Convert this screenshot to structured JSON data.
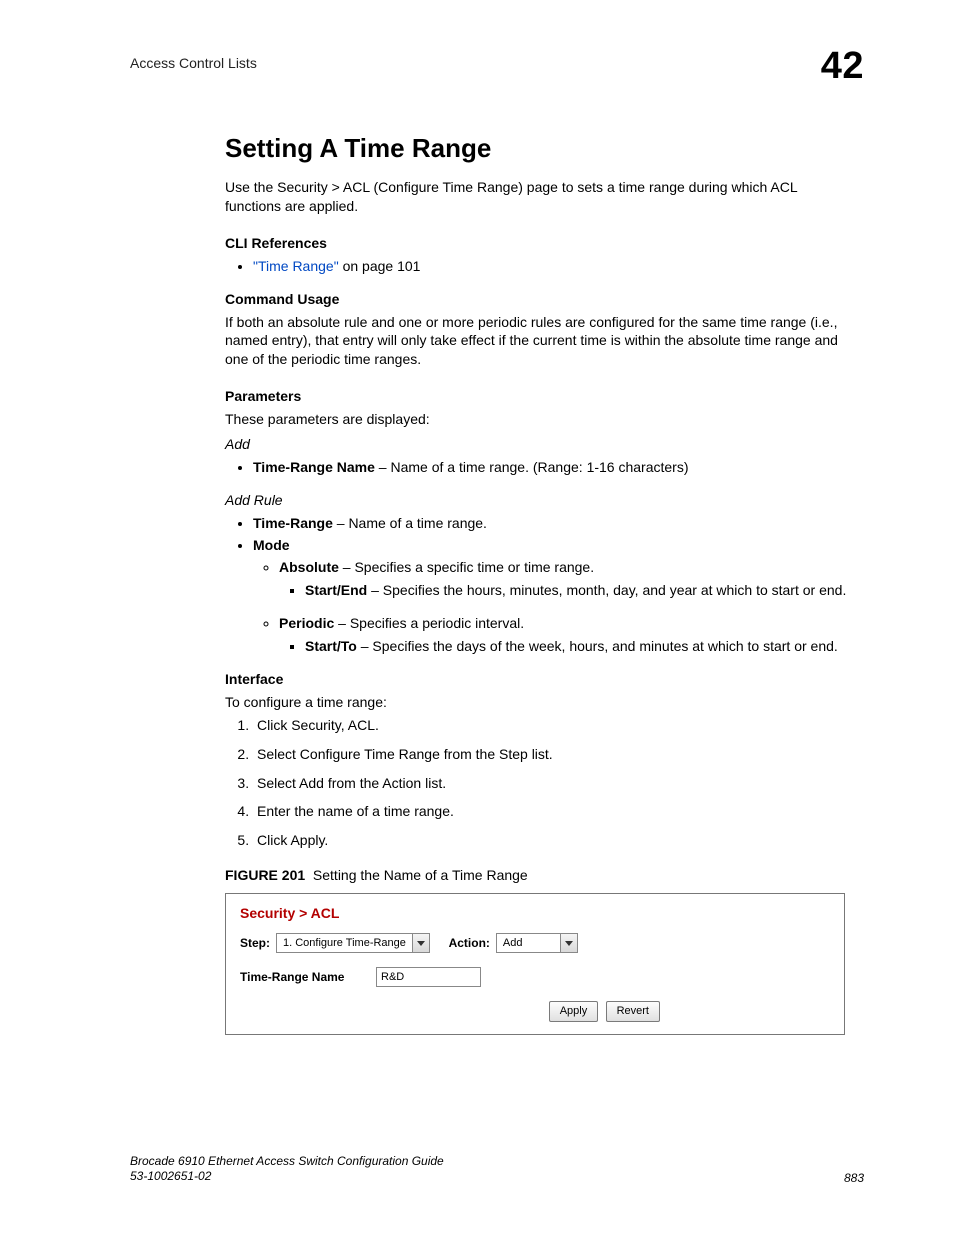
{
  "runningHead": "Access Control Lists",
  "chapterNumber": "42",
  "title": "Setting A Time Range",
  "intro": "Use the Security > ACL (Configure Time Range) page to sets a time range during which ACL functions are applied.",
  "cli": {
    "heading": "CLI References",
    "linkText": "\"Time Range\"",
    "linkTail": " on page 101"
  },
  "commandUsage": {
    "heading": "Command Usage",
    "text": "If both an absolute rule and one or more periodic rules are configured for the same time range (i.e., named entry), that entry will only take effect if the current time is within the absolute time range and one of the periodic time ranges."
  },
  "parameters": {
    "heading": "Parameters",
    "intro": "These parameters are displayed:",
    "addLabel": "Add",
    "addItem": {
      "name": "Time-Range Name",
      "desc": " – Name of a time range. (Range: 1-16 characters)"
    },
    "addRuleLabel": "Add Rule",
    "addRule": {
      "timeRange": {
        "name": "Time-Range",
        "desc": " – Name of a time range."
      },
      "mode": {
        "name": "Mode",
        "absolute": {
          "name": "Absolute",
          "desc": " – Specifies a specific time or time range."
        },
        "absoluteSub": {
          "name": "Start/End",
          "desc": " – Specifies the hours, minutes, month, day, and year at which to start or end."
        },
        "periodic": {
          "name": "Periodic",
          "desc": " – Specifies a periodic interval."
        },
        "periodicSub": {
          "name": "Start/To",
          "desc": " – Specifies the days of the week, hours, and minutes at which to start or end."
        }
      }
    }
  },
  "interfaceSec": {
    "heading": "Interface",
    "intro": "To configure a time range:",
    "steps": [
      "Click Security, ACL.",
      "Select Configure Time Range from the Step list.",
      "Select Add from the Action list.",
      "Enter the name of a time range.",
      "Click Apply."
    ]
  },
  "figure": {
    "label": "FIGURE 201",
    "caption": "Setting the Name of a Time Range"
  },
  "ui": {
    "breadcrumb": "Security > ACL",
    "stepLabel": "Step:",
    "stepValue": "1. Configure Time-Range",
    "actionLabel": "Action:",
    "actionValue": "Add",
    "fieldLabel": "Time-Range Name",
    "fieldValue": "R&D",
    "applyBtn": "Apply",
    "revertBtn": "Revert"
  },
  "footer": {
    "line1": "Brocade 6910 Ethernet Access Switch Configuration Guide",
    "line2": "53-1002651-02",
    "pageNumber": "883"
  }
}
